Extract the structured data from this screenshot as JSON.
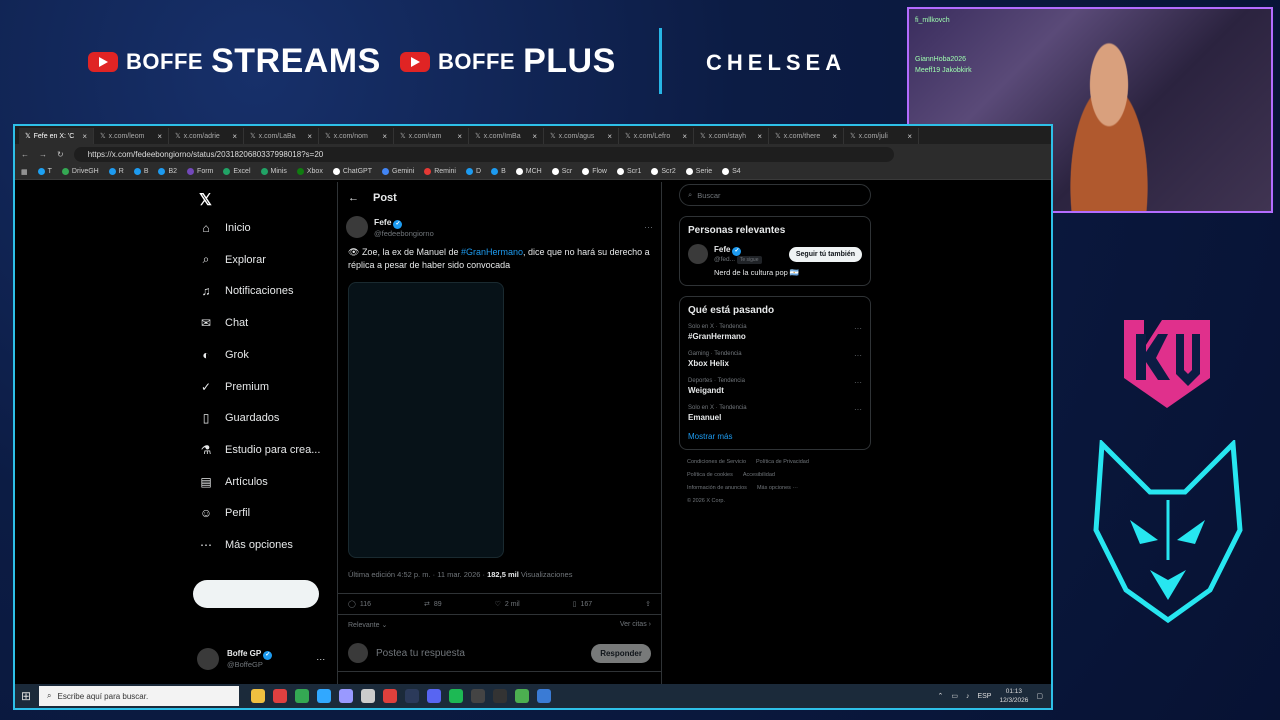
{
  "overlay": {
    "brand1_small": "BOFFE",
    "brand1_big": "STREAMS",
    "brand2_small": "BOFFE",
    "brand2_big": "PLUS",
    "sponsor": "CHELSEA",
    "accent_color": "#27b6e6",
    "kru_logo": "kru-logo",
    "fox_logo": "fox-logo"
  },
  "webcam": {
    "chat_lines": [
      "fi_mllkovch",
      "GiannHoba2026",
      "Meeff19 Jakobkirk"
    ]
  },
  "browser": {
    "tabs": [
      {
        "label": "Fefe en X: 'C",
        "active": true
      },
      {
        "label": "x.com/leom",
        "active": false
      },
      {
        "label": "x.com/adrie",
        "active": false
      },
      {
        "label": "x.com/LaBa",
        "active": false
      },
      {
        "label": "x.com/nom",
        "active": false
      },
      {
        "label": "x.com/ram",
        "active": false
      },
      {
        "label": "x.com/ImBa",
        "active": false
      },
      {
        "label": "x.com/agus",
        "active": false
      },
      {
        "label": "x.com/Lefro",
        "active": false
      },
      {
        "label": "x.com/stayh",
        "active": false
      },
      {
        "label": "x.com/there",
        "active": false
      },
      {
        "label": "x.com/juli",
        "active": false
      }
    ],
    "url": "https://x.com/fedeebongiorno/status/2031820680337998018?s=20",
    "bookmarks": [
      {
        "label": "T",
        "color": "#1da1f2"
      },
      {
        "label": "DriveGH",
        "color": "#34a853"
      },
      {
        "label": "R",
        "color": "#1d9bf0"
      },
      {
        "label": "B",
        "color": "#1d9bf0"
      },
      {
        "label": "B2",
        "color": "#1d9bf0"
      },
      {
        "label": "Form",
        "color": "#7248b9"
      },
      {
        "label": "Excel",
        "color": "#21a366"
      },
      {
        "label": "Minis",
        "color": "#21a366"
      },
      {
        "label": "Xbox",
        "color": "#107c10"
      },
      {
        "label": "ChatGPT",
        "color": "#ffffff"
      },
      {
        "label": "Gemini",
        "color": "#4285f4"
      },
      {
        "label": "Remini",
        "color": "#e53935"
      },
      {
        "label": "D",
        "color": "#1d9bf0"
      },
      {
        "label": "B",
        "color": "#1d9bf0"
      },
      {
        "label": "MCH",
        "color": "#ffffff"
      },
      {
        "label": "Scr",
        "color": "#ffffff"
      },
      {
        "label": "Flow",
        "color": "#ffffff"
      },
      {
        "label": "Scr1",
        "color": "#ffffff"
      },
      {
        "label": "Scr2",
        "color": "#ffffff"
      },
      {
        "label": "Serie",
        "color": "#ffffff"
      },
      {
        "label": "S4",
        "color": "#ffffff"
      }
    ]
  },
  "nav": {
    "items": [
      {
        "label": "Inicio",
        "icon": "home-icon",
        "glyph": "⌂"
      },
      {
        "label": "Explorar",
        "icon": "search-icon",
        "glyph": "⌕"
      },
      {
        "label": "Notificaciones",
        "icon": "bell-icon",
        "glyph": "♫"
      },
      {
        "label": "Chat",
        "icon": "chat-icon",
        "glyph": "✉"
      },
      {
        "label": "Grok",
        "icon": "grok-icon",
        "glyph": "◐"
      },
      {
        "label": "Premium",
        "icon": "premium-icon",
        "glyph": "✓"
      },
      {
        "label": "Guardados",
        "icon": "bookmark-icon",
        "glyph": "▯"
      },
      {
        "label": "Estudio para crea...",
        "icon": "studio-icon",
        "glyph": "⚗"
      },
      {
        "label": "Artículos",
        "icon": "articles-icon",
        "glyph": "▤"
      },
      {
        "label": "Perfil",
        "icon": "profile-icon",
        "glyph": "☺"
      },
      {
        "label": "Más opciones",
        "icon": "more-icon",
        "glyph": "⋯"
      }
    ],
    "account_name": "Boffe GP",
    "account_handle": "@BoffeGP"
  },
  "post": {
    "header": "Post",
    "author_name": "Fefe",
    "author_handle": "@fedeebongiorno",
    "text_emoji": "👁",
    "text_before": " Zoe, la ex de Manuel de ",
    "hashtag": "#GranHermano",
    "text_after": ", dice que no hará su derecho a réplica a pesar de haber sido convocada",
    "edited": "Última edición 4:52 p. m. · 11 mar. 2026 · ",
    "views_count": "182,5 mil",
    "views_label": " Visualizaciones",
    "replies": "116",
    "reposts": "89",
    "likes": "2 mil",
    "bookmarks": "167",
    "sort_label": "Relevante",
    "quotes_label": "Ver citas",
    "reply_placeholder": "Postea tu respuesta",
    "reply_button": "Responder"
  },
  "sidebar": {
    "search_placeholder": "Buscar",
    "relevant_title": "Personas relevantes",
    "relevant_name": "Fefe",
    "relevant_handle": "@fed...",
    "relevant_badge": "Te sigue",
    "relevant_bio": "Nerd de la cultura pop 🇦🇷",
    "follow_button": "Seguir tú también",
    "trends_title": "Qué está pasando",
    "trends": [
      {
        "category": "Solo en X · Tendencia",
        "name": "#GranHermano"
      },
      {
        "category": "Gaming · Tendencia",
        "name": "Xbox Helix"
      },
      {
        "category": "Deportes · Tendencia",
        "name": "Weigandt"
      },
      {
        "category": "Solo en X · Tendencia",
        "name": "Emanuel"
      }
    ],
    "show_more": "Mostrar más",
    "footer": [
      "Condiciones de Servicio",
      "Política de Privacidad",
      "Política de cookies",
      "Accesibilidad",
      "Información de anuncios",
      "Más opciones ···",
      "© 2026 X Corp."
    ]
  },
  "taskbar": {
    "search_placeholder": "Escribe aquí para buscar.",
    "language": "ESP",
    "time": "01:13",
    "date": "12/3/2026",
    "app_colors": [
      "#f0c040",
      "#e04040",
      "#34a853",
      "#31a8ff",
      "#9999ff",
      "#cccccc",
      "#e0403c",
      "#2b3a5a",
      "#5865f2",
      "#1db954",
      "#444444",
      "#333333",
      "#4caf50",
      "#3a7bd5"
    ]
  }
}
